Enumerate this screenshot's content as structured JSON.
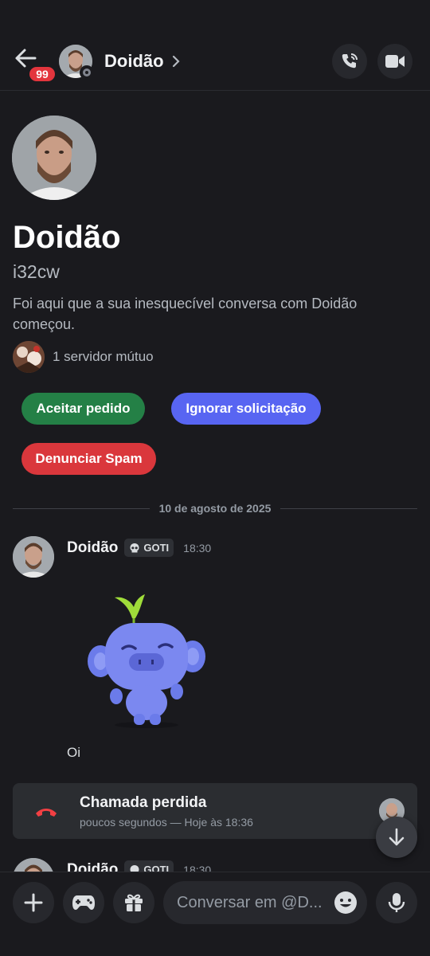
{
  "header": {
    "unread_count": "99",
    "dm_name": "Doidão"
  },
  "profile": {
    "display_name": "Doidão",
    "username": "i32cw",
    "intro": "Foi aqui que a sua inesquecível conversa com Doidão começou.",
    "mutual_servers": "1 servidor mútuo"
  },
  "actions": {
    "accept": "Aceitar pedido",
    "ignore": "Ignorar solicitação",
    "report": "Denunciar Spam"
  },
  "divider": {
    "date": "10 de agosto de 2025"
  },
  "messages": [
    {
      "author": "Doidão",
      "tag": "GOTI",
      "time": "18:30",
      "text": "Oi"
    },
    {
      "author": "Doidão",
      "tag": "GOTI",
      "time": "18:30"
    }
  ],
  "call": {
    "title": "Chamada perdida",
    "subtitle": "poucos segundos — Hoje às 18:36"
  },
  "composer": {
    "placeholder": "Conversar em @D..."
  },
  "colors": {
    "background": "#1a1a1e",
    "accept": "#248046",
    "ignore": "#5865f2",
    "report": "#da373c",
    "badge": "#e3353d"
  }
}
